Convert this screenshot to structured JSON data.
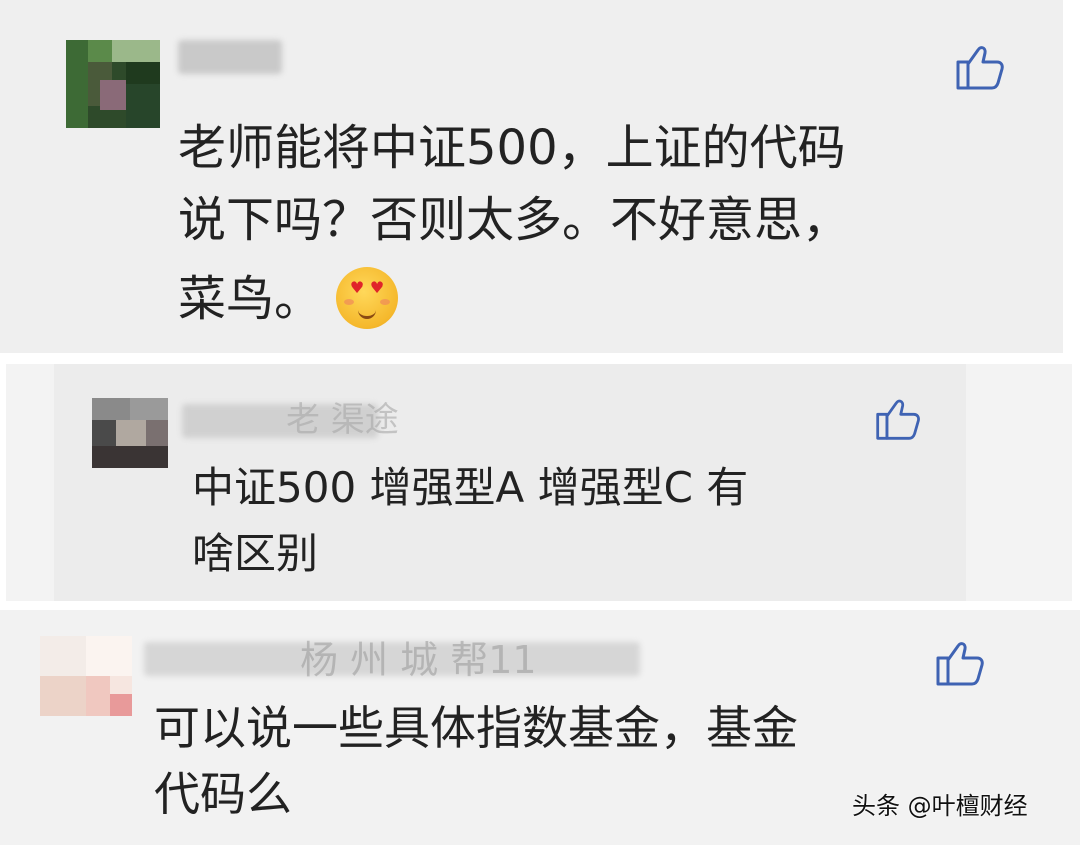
{
  "comments": [
    {
      "text_line1": "老师能将中证500，上证的代码",
      "text_line2": "说下吗？否则太多。不好意思，",
      "text_line3": "菜鸟。",
      "emoji": "heart-eyes-face-icon",
      "like_icon": "thumbs-up-icon"
    },
    {
      "name_partial": "老  渠途",
      "text_line1": "中证500  增强型A  增强型C 有",
      "text_line2": "啥区别",
      "like_icon": "thumbs-up-icon"
    },
    {
      "name_partial": "杨 州   城 帮11",
      "text_line1": "可以说一些具体指数基金，基金",
      "text_line2": "代码么",
      "like_icon": "thumbs-up-icon"
    }
  ],
  "watermark": "头条 @叶檀财经",
  "colors": {
    "like_icon": "#3f63b3",
    "text": "#222222",
    "card_bg": "#efefef"
  }
}
